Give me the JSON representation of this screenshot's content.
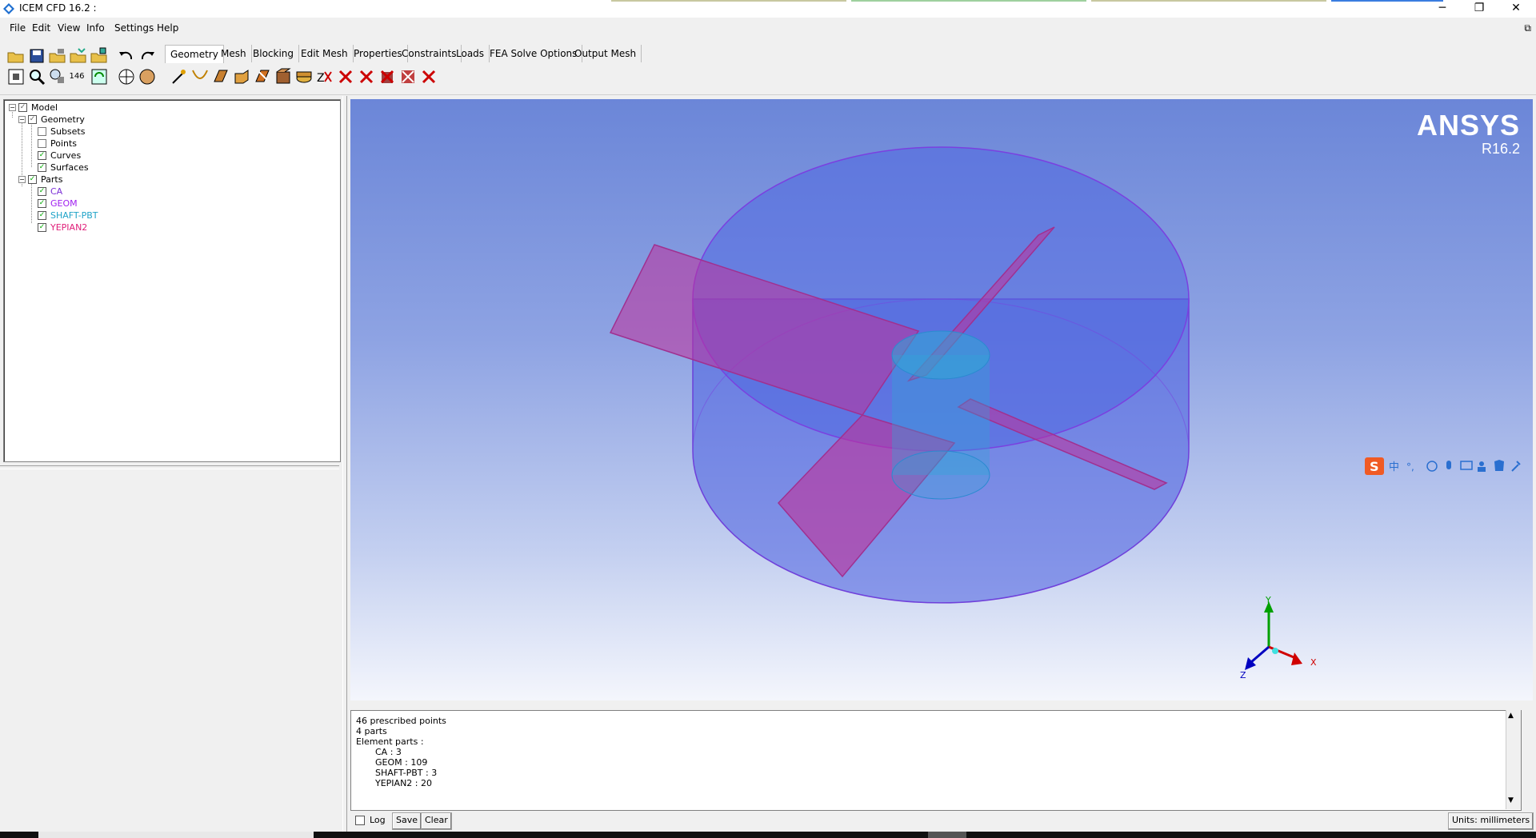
{
  "window": {
    "title": "ICEM CFD 16.2 :",
    "minimize": "─",
    "maximize": "❐",
    "close": "✕"
  },
  "menu": [
    "File",
    "Edit",
    "View",
    "Info",
    "Settings",
    "Help"
  ],
  "tabs": [
    "Geometry",
    "Mesh",
    "Blocking",
    "Edit Mesh",
    "Properties",
    "Constraints",
    "Loads",
    "FEA Solve Options",
    "Output Mesh"
  ],
  "active_tab": "Geometry",
  "toolbar_text": "146",
  "tree": {
    "model": "Model",
    "geometry": "Geometry",
    "subsets": "Subsets",
    "points": "Points",
    "curves": "Curves",
    "surfaces": "Surfaces",
    "parts": "Parts",
    "part_items": [
      {
        "label": "CA",
        "color": "#7b2fd6"
      },
      {
        "label": "GEOM",
        "color": "#a020f0"
      },
      {
        "label": "SHAFT-PBT",
        "color": "#1fa3c8"
      },
      {
        "label": "YEPIAN2",
        "color": "#e0207a"
      }
    ]
  },
  "viewport": {
    "brand": "ANSYS",
    "version": "R16.2",
    "axes": {
      "x": "X",
      "y": "Y",
      "z": "Z"
    },
    "colors": {
      "domain": "#4a5fe0",
      "blades": "#c0309a",
      "shaft": "#2fa7d6"
    }
  },
  "console": {
    "lines": [
      "46 prescribed points",
      "4 parts",
      "Element parts :",
      "CA : 3",
      "GEOM : 109",
      "SHAFT-PBT : 3",
      "YEPIAN2 : 20"
    ]
  },
  "bottom": {
    "log_label": "Log",
    "save_label": "Save",
    "clear_label": "Clear",
    "units": "Units: millimeters"
  }
}
